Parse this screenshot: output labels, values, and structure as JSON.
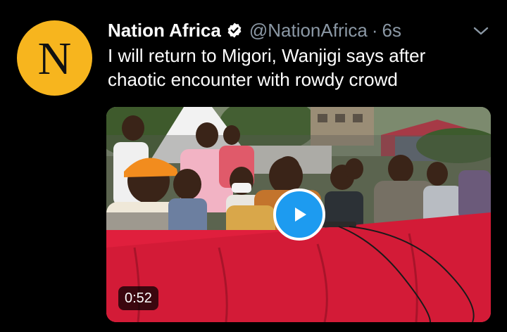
{
  "tweet": {
    "avatar_letter": "N",
    "display_name": "Nation Africa",
    "handle": "@NationAfrica",
    "separator": "·",
    "time": "6s",
    "text": "I will return to Migori, Wanjigi says after chaotic encounter with rowdy crowd",
    "verified": true
  },
  "media": {
    "type": "video",
    "duration": "0:52"
  },
  "icons": {
    "verified": "verified-badge-icon",
    "more": "chevron-down-icon",
    "play": "play-icon"
  },
  "colors": {
    "background": "#000000",
    "avatar": "#f7b51e",
    "secondary_text": "#8b98a5",
    "play_button": "#1d9bf0"
  }
}
